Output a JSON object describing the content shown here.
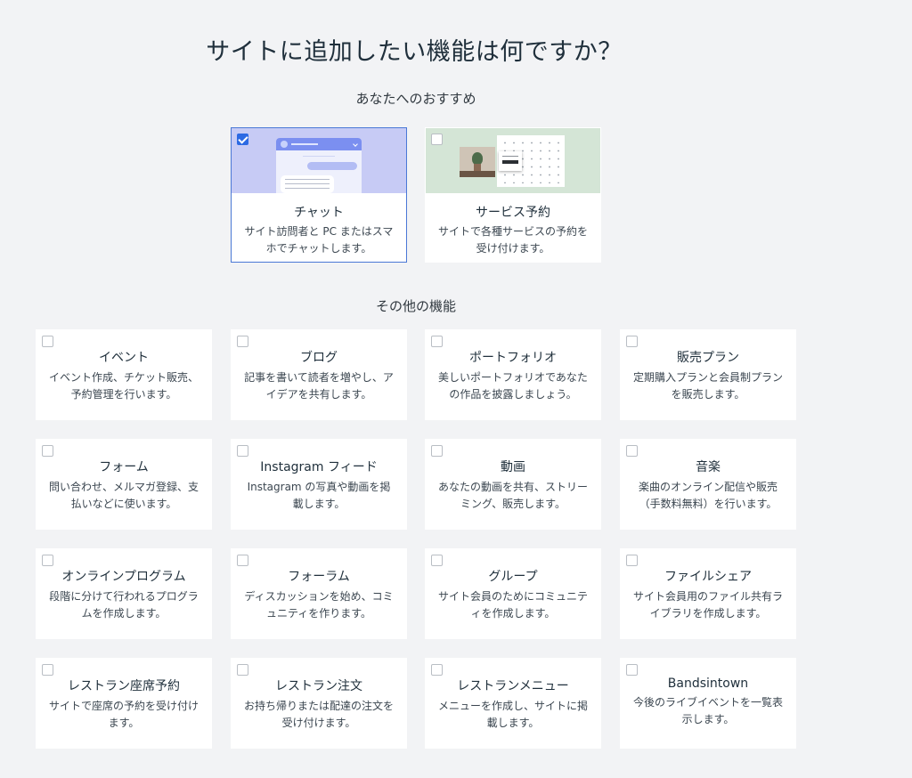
{
  "page_title": "サイトに追加したい機能は何ですか？",
  "recommended": {
    "section_title": "あなたへのおすすめ",
    "cards": [
      {
        "name": "チャット",
        "desc": "サイト訪問者と PC またはスマホでチャットします。",
        "checked": true
      },
      {
        "name": "サービス予約",
        "desc": "サイトで各種サービスの予約を受け付けます。",
        "checked": false
      }
    ]
  },
  "other": {
    "section_title": "その他の機能",
    "cards": [
      {
        "name": "イベント",
        "desc": "イベント作成、チケット販売、予約管理を行います。",
        "checked": false
      },
      {
        "name": "ブログ",
        "desc": "記事を書いて読者を増やし、アイデアを共有します。",
        "checked": false
      },
      {
        "name": "ポートフォリオ",
        "desc": "美しいポートフォリオであなたの作品を披露しましょう。",
        "checked": false
      },
      {
        "name": "販売プラン",
        "desc": "定期購入プランと会員制プランを販売します。",
        "checked": false
      },
      {
        "name": "フォーム",
        "desc": "問い合わせ、メルマガ登録、支払いなどに使います。",
        "checked": false
      },
      {
        "name": "Instagram フィード",
        "desc": "Instagram の写真や動画を掲載します。",
        "checked": false
      },
      {
        "name": "動画",
        "desc": "あなたの動画を共有、ストリーミング、販売します。",
        "checked": false
      },
      {
        "name": "音楽",
        "desc": "楽曲のオンライン配信や販売（手数料無料）を行います。",
        "checked": false
      },
      {
        "name": "オンラインプログラム",
        "desc": "段階に分けて行われるプログラムを作成します。",
        "checked": false
      },
      {
        "name": "フォーラム",
        "desc": "ディスカッションを始め、コミュニティを作ります。",
        "checked": false
      },
      {
        "name": "グループ",
        "desc": "サイト会員のためにコミュニティを作成します。",
        "checked": false
      },
      {
        "name": "ファイルシェア",
        "desc": "サイト会員用のファイル共有ライブラリを作成します。",
        "checked": false
      },
      {
        "name": "レストラン座席予約",
        "desc": "サイトで座席の予約を受け付けます。",
        "checked": false
      },
      {
        "name": "レストラン注文",
        "desc": "お持ち帰りまたは配達の注文を受け付けます。",
        "checked": false
      },
      {
        "name": "レストランメニュー",
        "desc": "メニューを作成し、サイトに掲載します。",
        "checked": false
      },
      {
        "name": "Bandsintown",
        "desc": "今後のライブイベントを一覧表示します。",
        "checked": false
      }
    ]
  }
}
